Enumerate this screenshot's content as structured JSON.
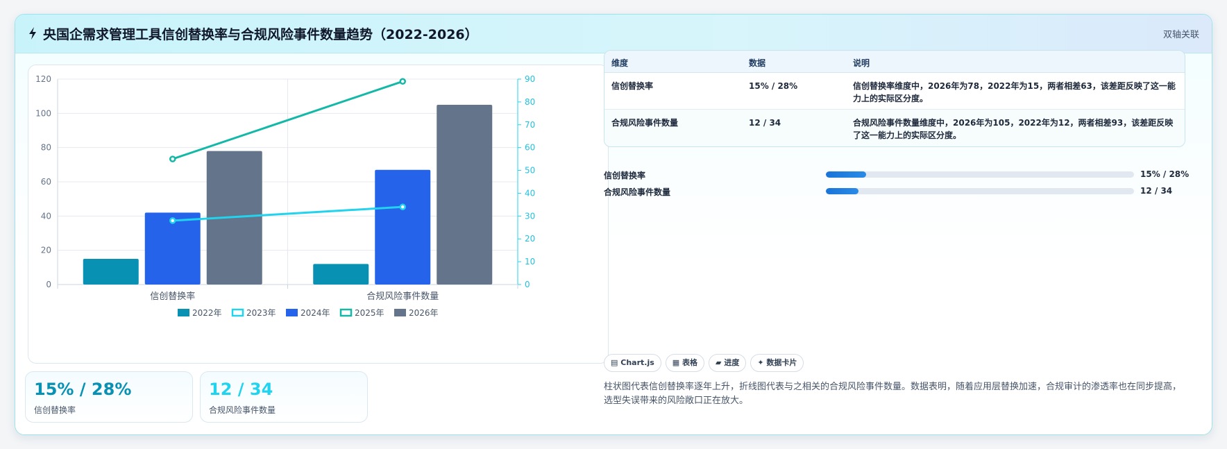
{
  "header": {
    "title": "央国企需求管理工具信创替换率与合规风险事件数量趋势（2022-2026）",
    "tag": "双轴关联"
  },
  "colors": {
    "y2022": "#0891b2",
    "y2023": "#22d3ee",
    "y2024": "#2563eb",
    "y2025": "#14b8a6",
    "y2026": "#64748b",
    "kpi1": "#0891b2",
    "kpi2": "#22d3ee"
  },
  "chart_data": {
    "type": "bar",
    "categories": [
      "信创替换率",
      "合规风险事件数量"
    ],
    "series": [
      {
        "name": "2022年",
        "type": "bar",
        "axis": "left",
        "values": [
          15,
          12
        ]
      },
      {
        "name": "2023年",
        "type": "line",
        "axis": "right",
        "values": [
          28,
          34
        ]
      },
      {
        "name": "2024年",
        "type": "bar",
        "axis": "left",
        "values": [
          42,
          67
        ]
      },
      {
        "name": "2025年",
        "type": "line",
        "axis": "right",
        "values": [
          55,
          89
        ]
      },
      {
        "name": "2026年",
        "type": "bar",
        "axis": "left",
        "values": [
          78,
          105
        ]
      }
    ],
    "ylim": [
      0,
      120
    ],
    "yticks": [
      "0",
      "20",
      "40",
      "60",
      "80",
      "100",
      "120"
    ],
    "y2lim": [
      0,
      90
    ],
    "y2ticks": [
      "0",
      "10",
      "20",
      "30",
      "40",
      "50",
      "60",
      "70",
      "80",
      "90"
    ],
    "grid": true,
    "legend": "bottom"
  },
  "kpis": [
    {
      "value": "15% / 28%",
      "label": "信创替换率"
    },
    {
      "value": "12 / 34",
      "label": "合规风险事件数量"
    }
  ],
  "table": {
    "headers": [
      "维度",
      "数据",
      "说明"
    ],
    "rows": [
      {
        "dim": "信创替换率",
        "data": "15% / 28%",
        "desc": "信创替换率维度中，2026年为78，2022年为15，两者相差63，该差距反映了这一能力上的实际区分度。"
      },
      {
        "dim": "合规风险事件数量",
        "data": "12 / 34",
        "desc": "合规风险事件数量维度中，2026年为105，2022年为12，两者相差93，该差距反映了这一能力上的实际区分度。"
      }
    ]
  },
  "progress": [
    {
      "label": "信创替换率",
      "value": "15% / 28%",
      "fraction": 0.13
    },
    {
      "label": "合规风险事件数量",
      "value": "12 / 34",
      "fraction": 0.105
    }
  ],
  "chips": [
    {
      "icon": "table-icon",
      "label": "Chart.js"
    },
    {
      "icon": "grid-icon",
      "label": "表格"
    },
    {
      "icon": "progress-icon",
      "label": "进度"
    },
    {
      "icon": "sparkle-icon",
      "label": "数据卡片"
    }
  ],
  "chip_glyphs": [
    "▤",
    "▦",
    "▰",
    "✦"
  ],
  "summary": "柱状图代表信创替换率逐年上升，折线图代表与之相关的合规风险事件数量。数据表明，随着应用层替换加速，合规审计的渗透率也在同步提高，选型失误带来的风险敞口正在放大。"
}
